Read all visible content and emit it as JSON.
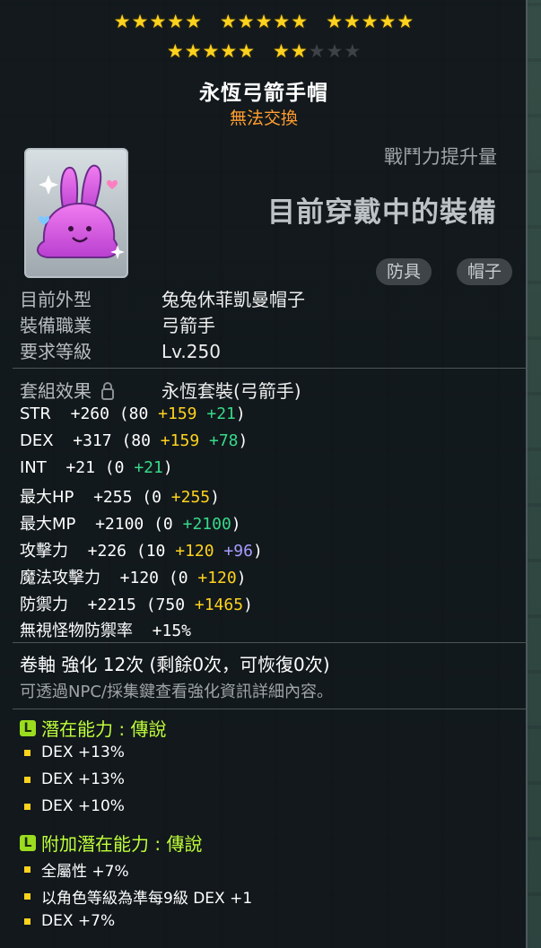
{
  "stars": {
    "rows": [
      [
        5,
        5,
        5
      ],
      [
        5,
        5
      ]
    ],
    "filled_rows": [
      [
        5,
        5,
        5
      ],
      [
        5,
        2
      ]
    ]
  },
  "item": {
    "name": "永恆弓箭手帽",
    "trade_status": "無法交換"
  },
  "power_label": "戰鬥力提升量",
  "equipped_label": "目前穿戴中的裝備",
  "tags": [
    "防具",
    "帽子"
  ],
  "info": [
    {
      "key": "目前外型",
      "value": "兔兔休菲凱曼帽子"
    },
    {
      "key": "裝備職業",
      "value": "弓箭手"
    },
    {
      "key": "要求等級",
      "value": "Lv.250"
    }
  ],
  "set_effect": {
    "key": "套組效果",
    "value": "永恆套裝(弓箭手)"
  },
  "stats": [
    {
      "label": "STR",
      "total": "+260",
      "base": "(80",
      "add1": "+159",
      "add1_color": "yel",
      "add2": "+21",
      "add2_color": "grn",
      "close": ")"
    },
    {
      "label": "DEX",
      "total": "+317",
      "base": "(80",
      "add1": "+159",
      "add1_color": "yel",
      "add2": "+78",
      "add2_color": "grn",
      "close": ")"
    },
    {
      "label": "INT",
      "total": "+21",
      "base": "(0",
      "add1": "+21",
      "add1_color": "grn",
      "add2": "",
      "add2_color": "",
      "close": ")"
    },
    {
      "label": "最大HP",
      "total": "+255",
      "base": "(0",
      "add1": "+255",
      "add1_color": "yel",
      "add2": "",
      "add2_color": "",
      "close": ")"
    },
    {
      "label": "最大MP",
      "total": "+2100",
      "base": "(0",
      "add1": "+2100",
      "add1_color": "grn",
      "add2": "",
      "add2_color": "",
      "close": ")"
    },
    {
      "label": "攻擊力",
      "total": "+226",
      "base": "(10",
      "add1": "+120",
      "add1_color": "yel",
      "add2": "+96",
      "add2_color": "pur",
      "close": ")"
    },
    {
      "label": "魔法攻擊力",
      "total": "+120",
      "base": "(0",
      "add1": "+120",
      "add1_color": "yel",
      "add2": "",
      "add2_color": "",
      "close": ")"
    },
    {
      "label": "防禦力",
      "total": "+2215",
      "base": "(750",
      "add1": "+1465",
      "add1_color": "yel",
      "add2": "",
      "add2_color": "",
      "close": ")"
    },
    {
      "label": "無視怪物防禦率",
      "total": "+15%",
      "base": "",
      "add1": "",
      "add1_color": "",
      "add2": "",
      "add2_color": "",
      "close": ""
    }
  ],
  "scroll": {
    "line": "卷軸 強化 12次 (剩餘0次，可恢復0次)",
    "hint": "可透過NPC/採集鍵查看強化資訊詳細內容。"
  },
  "potential": {
    "grade_letter": "L",
    "title": "潛在能力 : 傳說",
    "lines": [
      "DEX +13%",
      "DEX +13%",
      "DEX +10%"
    ]
  },
  "bonus_potential": {
    "grade_letter": "L",
    "title": "附加潛在能力 : 傳說",
    "lines": [
      "全屬性 +7%",
      "以角色等級為準每9級 DEX +1",
      "DEX +7%"
    ]
  },
  "colors": {
    "star": "#ffd21e",
    "trade": "#ff9d2f",
    "legendary": "#bfff3a",
    "green_bonus": "#37d98a",
    "yellow_bonus": "#ffd21e",
    "purple_bonus": "#a89cff"
  },
  "icons": {
    "item": "pink-bunny-cap-icon",
    "lock": "lock-icon",
    "grade": "legendary-grade-icon",
    "bullet": "square-bullet-icon"
  }
}
